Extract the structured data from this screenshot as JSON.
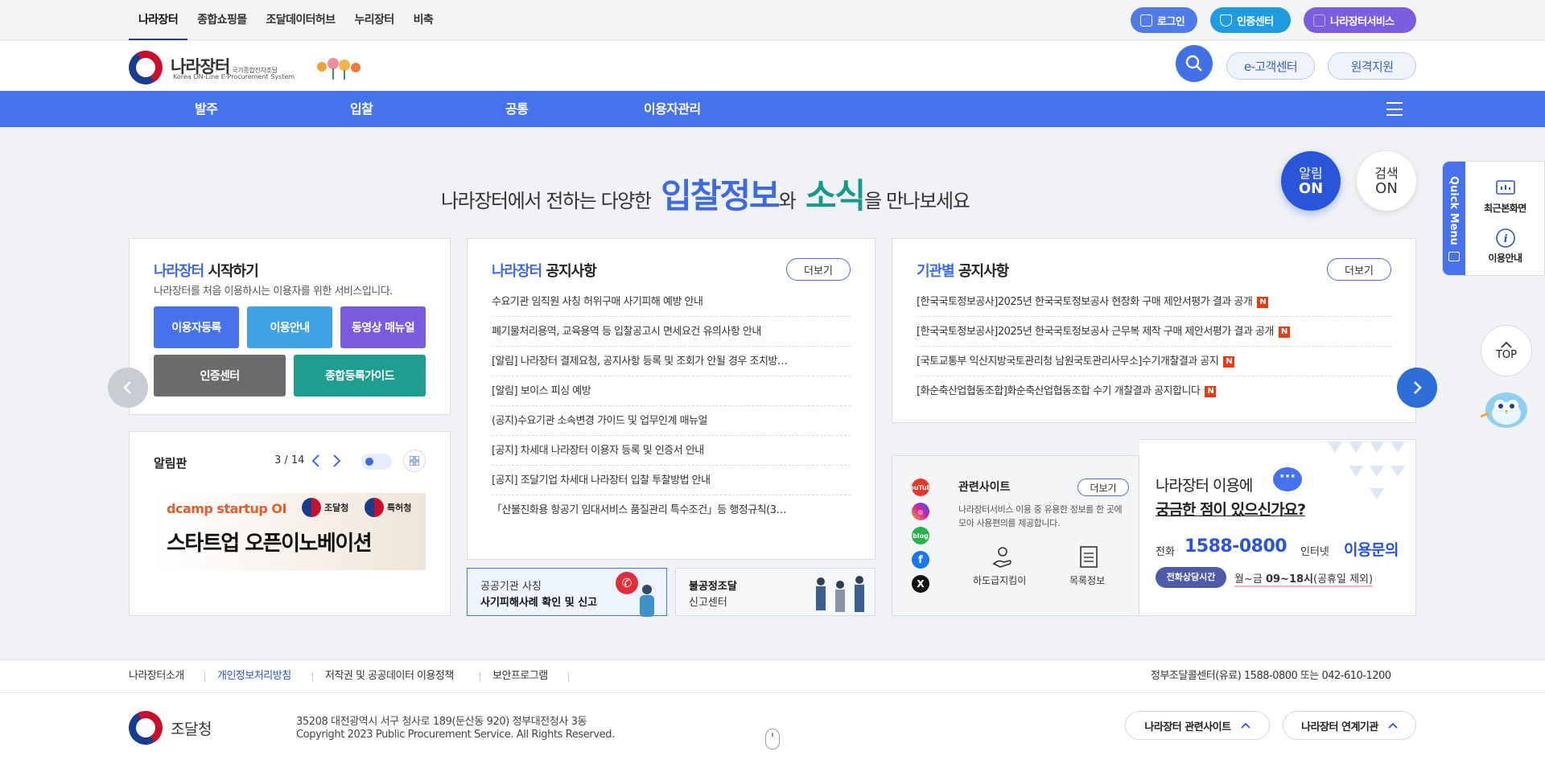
{
  "topbar": {
    "nav": [
      "나라장터",
      "종합쇼핑몰",
      "조달데이터허브",
      "누리장터",
      "비축"
    ],
    "login": "로그인",
    "cert": "인증센터",
    "services": "나라장터서비스"
  },
  "header": {
    "logo_title": "나라장터",
    "logo_title_small": "국가종합전자조달",
    "logo_sub": "Korea ON-Line E-Procurement System",
    "customer_center": "e-고객센터",
    "remote_support": "원격지원"
  },
  "gnb": [
    "발주",
    "입찰",
    "공통",
    "이용자관리"
  ],
  "headline": {
    "pre": "나라장터에서 전하는 다양한",
    "em1": "입찰정보",
    "mid": "와",
    "em2": "소식",
    "post": "을 만나보세요"
  },
  "toggles": {
    "alert_l1": "알림",
    "alert_l2": "ON",
    "search_l1": "검색",
    "search_l2": "ON"
  },
  "start": {
    "title_accent": "나라장터",
    "title_rest": "시작하기",
    "desc": "나라장터를 처음 이용하시는 이용자를 위한 서비스입니다.",
    "buttons": [
      "이용자등록",
      "이용안내",
      "동영상 매뉴얼",
      "인증센터",
      "종합등록가이드"
    ]
  },
  "board": {
    "title": "알림판",
    "page": "3 / 14",
    "banner_brand": "dcamp startup OI",
    "banner_org1": "조달청",
    "banner_org2": "특허청",
    "banner_title": "스타트업 오픈이노베이션"
  },
  "notice": {
    "title_accent": "나라장터",
    "title_rest": "공지사항",
    "more": "더보기",
    "items": [
      "수요기관 임직원 사칭 허위구매 사기피해 예방 안내",
      "폐기물처리용역, 교육용역 등 입찰공고시 면세요건 유의사항 안내",
      "[알림] 나라장터 결제요청, 공지사항 등록 및 조회가 안될 경우 조치방…",
      "[알림] 보이스 피싱 예방",
      "(공지)수요기관 소속변경 가이드 및 업무인계 매뉴얼",
      "[공지] 차세대 나라장터 이용자 등록 및 인증서 안내",
      "[공지] 조달기업 차세대 나라장터 입찰 투찰방법 안내",
      "「산불진화용 항공기 임대서비스 품질관리 특수조건」등 행정규칙(3…"
    ]
  },
  "agency": {
    "title_accent": "기관별",
    "title_rest": "공지사항",
    "more": "더보기",
    "new_badge": "N",
    "items": [
      "[한국국토정보공사]2025년 한국국토정보공사 현장화 구매 제안서평가 결과 공개",
      "[한국국토정보공사]2025년 한국국토정보공사 근무복 제작 구매 제안서평가 결과 공개",
      "[국토교통부 익산지방국토관리청 남원국토관리사무소]수기개찰결과 공지",
      "[화순축산업협동조합]화순축산업협동조합 수기 개찰결과 공지합니다"
    ]
  },
  "fraud": {
    "line1": "공공기관 사칭",
    "line2": "사기피해사례 확인 및 신고"
  },
  "illegal": {
    "line1": "불공정조달",
    "line2": "신고센터"
  },
  "related": {
    "title": "관련사이트",
    "more": "더보기",
    "desc": "나라장터서비스 이용 중 유용한 정보를 한 곳에 모아 사용편의를 제공합니다.",
    "link1": "하도급지킴이",
    "link2": "목록정보",
    "social": [
      "YouTube",
      "blog"
    ]
  },
  "contact": {
    "q1": "나라장터 이용에",
    "q2": "궁금한 점이 있으신가요?",
    "phone_label": "전화",
    "phone": "1588-0800",
    "web_label": "인터넷",
    "web": "이용문의",
    "hours_badge": "전화상담시간",
    "hours_pre": "월~금",
    "hours_main": "09~18시",
    "hours_post": "(공휴일 제외)"
  },
  "quick": {
    "tab": "Quick Menu",
    "recent": "최근본화면",
    "guide": "이용안내",
    "top": "TOP"
  },
  "footer": {
    "links": [
      "나라장터소개",
      "개인정보처리방침",
      "저작권 및 공공데이터 이용정책",
      "보안프로그램"
    ],
    "callcenter": "정부조달콜센터(유료) 1588-0800 또는 042-610-1200",
    "org": "조달청",
    "address": "35208 대전광역시 서구 청사로 189(둔산동 920) 정부대전청사 3동",
    "copyright": "Copyright 2023 Public Procurement Service. All Rights Reserved.",
    "related_btn": "나라장터 관련사이트",
    "linked_btn": "나라장터 연계기관"
  },
  "colors": {
    "primary": "#4673ec",
    "teal": "#1d9e8f",
    "purple": "#7a5be0",
    "alert": "#2a55d9"
  }
}
